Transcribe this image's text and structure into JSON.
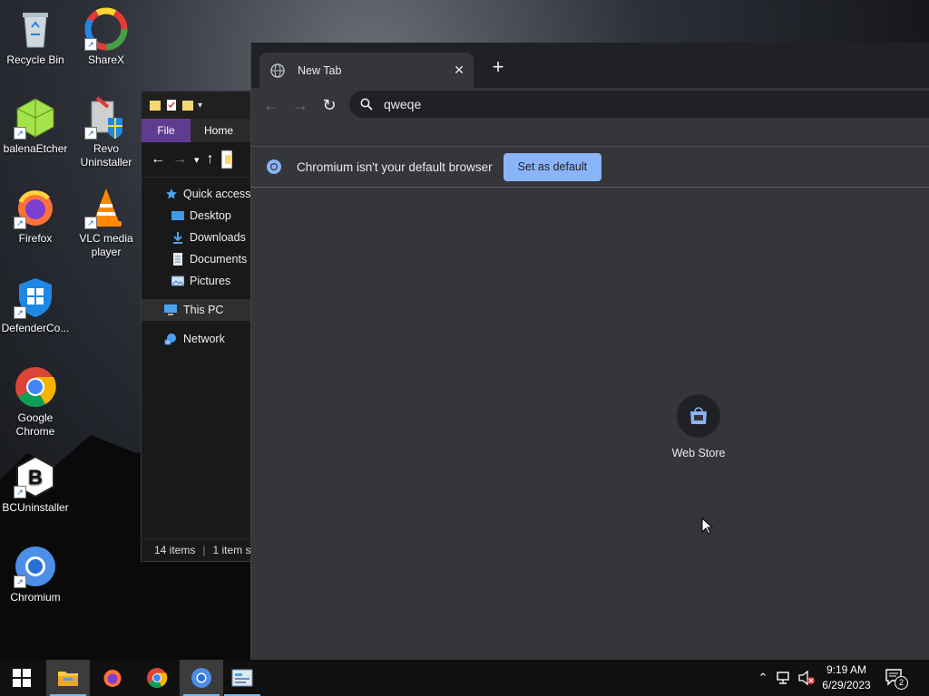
{
  "desktop": {
    "icons": [
      {
        "label": "Recycle Bin",
        "icon": "recycle-bin-icon"
      },
      {
        "label": "ShareX",
        "icon": "sharex-icon"
      },
      {
        "label": "balenaEtcher",
        "icon": "balenaetcher-icon"
      },
      {
        "label": "Revo Uninstaller",
        "icon": "revo-uninstaller-icon"
      },
      {
        "label": "Firefox",
        "icon": "firefox-icon"
      },
      {
        "label": "VLC media player",
        "icon": "vlc-icon"
      },
      {
        "label": "DefenderCo...",
        "icon": "defender-control-icon"
      },
      {
        "label": "Google Chrome",
        "icon": "chrome-icon"
      },
      {
        "label": "BCUninstaller",
        "icon": "bcuninstaller-icon"
      },
      {
        "label": "Chromium",
        "icon": "chromium-icon"
      }
    ]
  },
  "explorer": {
    "ribbon": {
      "file": "File",
      "home": "Home"
    },
    "nav": {
      "quick_access": "Quick access",
      "desktop": "Desktop",
      "downloads": "Downloads",
      "documents": "Documents",
      "pictures": "Pictures",
      "this_pc": "This PC",
      "network": "Network"
    },
    "status": {
      "items": "14 items",
      "selected": "1 item s"
    }
  },
  "browser": {
    "tab_title": "New Tab",
    "omnibox_value": "qweqe",
    "infobar_message": "Chromium isn't your default browser",
    "infobar_button": "Set as default",
    "shortcut_label": "Web Store"
  },
  "taskbar": {
    "time": "9:19 AM",
    "date": "6/29/2023",
    "notification_count": "2"
  },
  "colors": {
    "accent_blue": "#8ab4f8",
    "file_tab": "#5e3d91",
    "chrome_bg": "#35363a",
    "tabstrip_bg": "#202124"
  }
}
